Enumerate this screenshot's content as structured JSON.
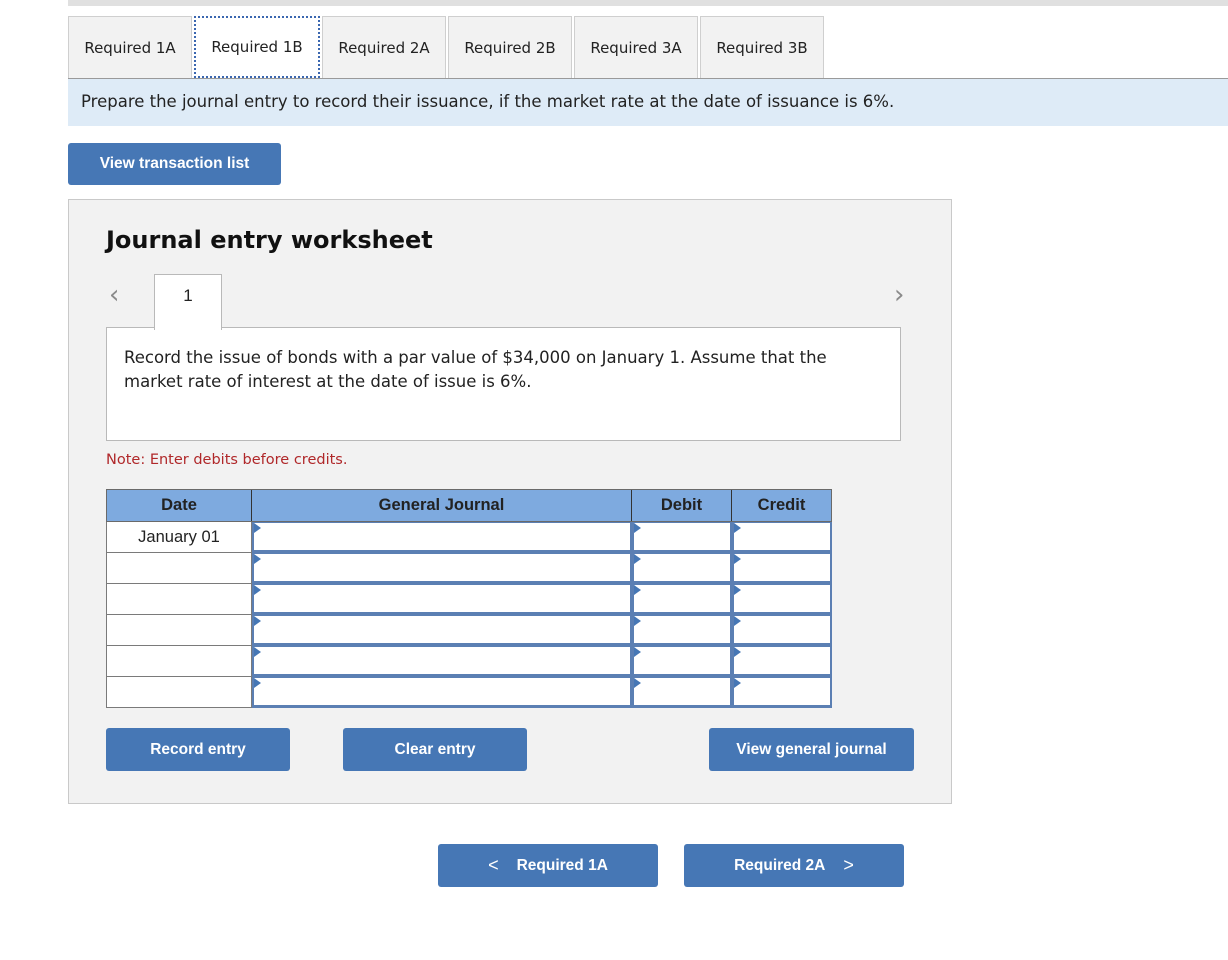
{
  "tabs": [
    {
      "label": "Required 1A",
      "active": false
    },
    {
      "label": "Required 1B",
      "active": true
    },
    {
      "label": "Required 2A",
      "active": false
    },
    {
      "label": "Required 2B",
      "active": false
    },
    {
      "label": "Required 3A",
      "active": false
    },
    {
      "label": "Required 3B",
      "active": false
    }
  ],
  "instruction": "Prepare the journal entry to record their issuance, if the market rate at the date of issuance is 6%.",
  "view_transaction_list": "View transaction list",
  "worksheet": {
    "title": "Journal entry worksheet",
    "prev_icon": "‹",
    "next_icon": "›",
    "entry_number": "1",
    "description": "Record the issue of bonds with a par value of $34,000 on January 1. Assume that the market rate of interest at the date of issue is 6%.",
    "note": "Note: Enter debits before credits.",
    "columns": {
      "date": "Date",
      "account": "General Journal",
      "debit": "Debit",
      "credit": "Credit"
    },
    "rows": [
      {
        "date": "January 01",
        "account": "",
        "debit": "",
        "credit": ""
      },
      {
        "date": "",
        "account": "",
        "debit": "",
        "credit": ""
      },
      {
        "date": "",
        "account": "",
        "debit": "",
        "credit": ""
      },
      {
        "date": "",
        "account": "",
        "debit": "",
        "credit": ""
      },
      {
        "date": "",
        "account": "",
        "debit": "",
        "credit": ""
      },
      {
        "date": "",
        "account": "",
        "debit": "",
        "credit": ""
      }
    ],
    "record_entry": "Record entry",
    "clear_entry": "Clear entry",
    "view_general_journal": "View general journal"
  },
  "footer_nav": {
    "prev_label": "Required 1A",
    "next_label": "Required 2A",
    "prev_icon": "<",
    "next_icon": ">"
  },
  "colors": {
    "button_blue": "#4677b5",
    "header_blue": "#7eaadf",
    "instruction_bg": "#deebf7",
    "note_red": "#b0282a"
  }
}
